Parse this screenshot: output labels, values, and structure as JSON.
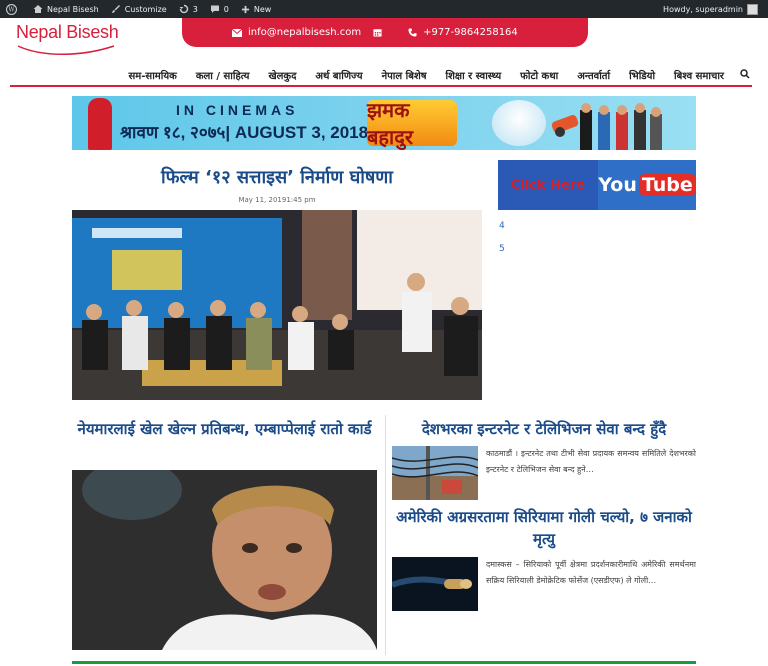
{
  "admin_bar": {
    "site_name": "Nepal Bisesh",
    "customize": "Customize",
    "updates": "3",
    "comments": "0",
    "new": "New",
    "howdy": "Howdy, superadmin"
  },
  "header": {
    "logo": "Nepal Bisesh",
    "email": "info@nepalbisesh.com",
    "phone": "+977-9864258164"
  },
  "nav": {
    "items": [
      "सम-सामयिक",
      "कला / साहित्य",
      "खेलकुद",
      "अर्थ बाणिज्य",
      "नेपाल बिशेष",
      "शिक्षा र स्वास्थ्य",
      "फोटो कथा",
      "अन्तर्वार्ता",
      "भिडियो",
      "बिश्व समाचार"
    ]
  },
  "banner": {
    "line1": "IN CINEMAS",
    "line2": "श्रावण १८, २०७५| AUGUST 3, 2018",
    "movie": "झमक बहादुर"
  },
  "side_ad": {
    "click_here": "Click Here",
    "you": "You",
    "tube": "Tube"
  },
  "side_numbers": [
    "4",
    "5"
  ],
  "lead": {
    "title": "फिल्म ‘१२ सत्ताइस’ निर्माण घोषणा",
    "date": "May 11, 20191:45 pm"
  },
  "left_article": {
    "title": "नेयमारलाई खेल खेल्न प्रतिबन्ध, एम्बाप्पेलाई रातो कार्ड"
  },
  "right_articles": [
    {
      "title": "देशभरका इन्टरनेट र टेलिभिजन सेवा बन्द हुँदै",
      "excerpt": "काठमाडौं । इन्टरनेट तथा टीभी सेवा प्रदायक समन्वय समितिले देशभरको इन्टरनेट र टेलिभिजन सेवा बन्द हुने…"
    },
    {
      "title": "अमेरिकी अग्रसरतामा सिरियामा गोली चल्यो, ७ जनाको मृत्यु",
      "excerpt": "दमास्कस – सिरियाको पूर्वी क्षेत्रमा प्रदर्शनकारीमाथि अमेरिकी समर्थनमा सक्रिय सिरियाली डेमोक्रेटिक फोर्सेज (एसडीएफ) ले गोली…"
    }
  ],
  "colors": {
    "brand": "#d81f3c",
    "headline": "#1b4c8a",
    "adminbar": "#23282d",
    "footer_line": "#1a9b3c"
  }
}
